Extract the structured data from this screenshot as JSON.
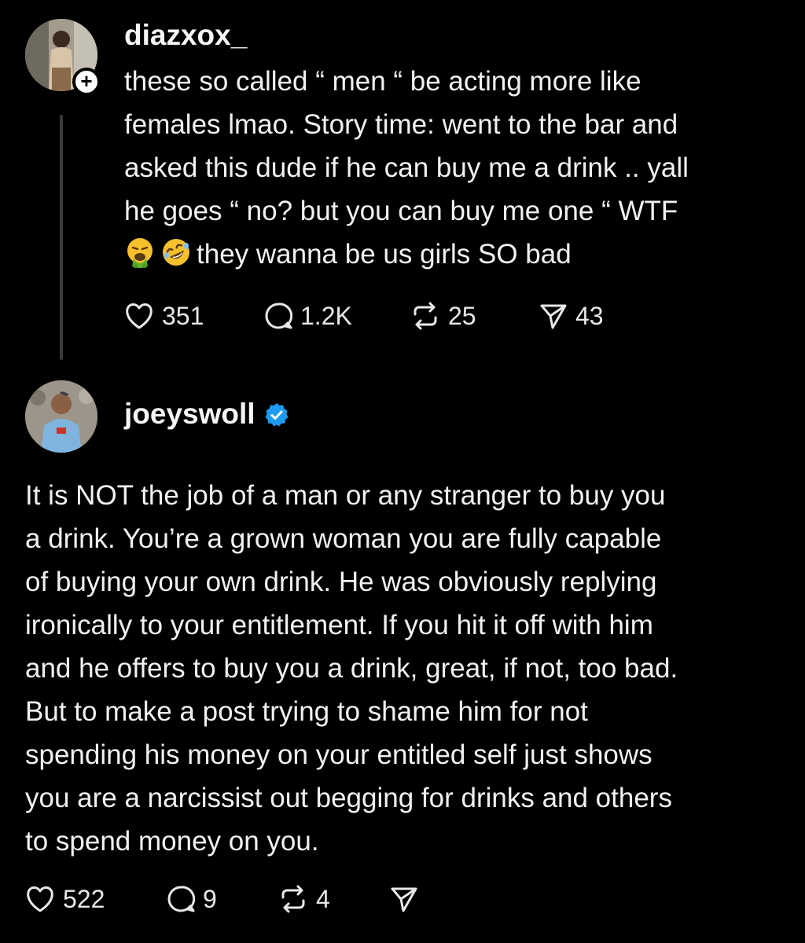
{
  "posts": [
    {
      "username": "diazxox_",
      "follow_symbol": "+",
      "lines": [
        "these so called “ men “ be acting more like",
        "females lmao. Story time: went to the bar and",
        "asked this dude if he can buy me a drink .. yall",
        "he goes “ no? but you can buy me one “ WTF",
        "they wanna be us girls SO bad"
      ],
      "emojis": [
        "vomiting-face",
        "rolling-on-floor-laughing"
      ],
      "actions": {
        "likes": "351",
        "replies": "1.2K",
        "reposts": "25",
        "shares": "43"
      }
    },
    {
      "username": "joeyswoll",
      "verified": true,
      "lines": [
        "It is NOT the job of a man or any stranger to buy you",
        "a drink. You’re a grown woman you are fully capable",
        "of buying your own drink. He was obviously replying",
        "ironically to your entitlement. If you hit it off with him",
        "and he offers to buy you a drink, great, if not, too bad.",
        "But to make a post trying to shame him for not",
        "spending his money on your entitled self just shows",
        "you are a narcissist out begging for drinks and others",
        "to spend money on you."
      ],
      "actions": {
        "likes": "522",
        "replies": "9",
        "reposts": "4"
      }
    }
  ],
  "colors": {
    "background": "#000000",
    "text": "#f1f1f1",
    "verified": "#1d9bf0",
    "thread_line": "#3a3a3a"
  }
}
